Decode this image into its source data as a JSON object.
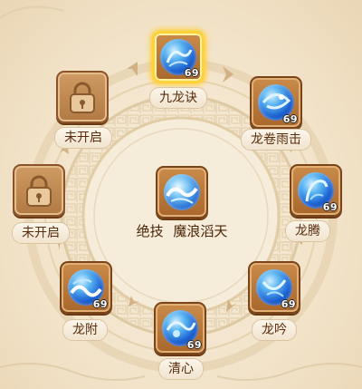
{
  "panel": {
    "colors": {
      "orb_blue": "#1a5fd0",
      "frame_brown": "#a9672c",
      "selected_gold": "#ffd23a",
      "label_text": "#5a2d0c"
    }
  },
  "center": {
    "label": "绝技",
    "skill_name": "魔浪滔天",
    "icon": "water-wave-dragon-icon"
  },
  "skills": [
    {
      "name": "九龙诀",
      "level": "69",
      "icon": "nine-dragon-icon",
      "selected": true
    },
    {
      "name": "龙卷雨击",
      "level": "69",
      "icon": "dragon-storm-icon"
    },
    {
      "name": "龙腾",
      "level": "69",
      "icon": "dragon-rise-icon"
    },
    {
      "name": "龙吟",
      "level": "69",
      "icon": "dragon-roar-icon"
    },
    {
      "name": "清心",
      "level": "69",
      "icon": "pure-heart-icon"
    },
    {
      "name": "龙附",
      "level": "69",
      "icon": "dragon-attach-icon"
    },
    {
      "name": "未开启",
      "icon": "lock-icon",
      "locked": true
    },
    {
      "name": "未开启",
      "icon": "lock-icon",
      "locked": true
    }
  ]
}
